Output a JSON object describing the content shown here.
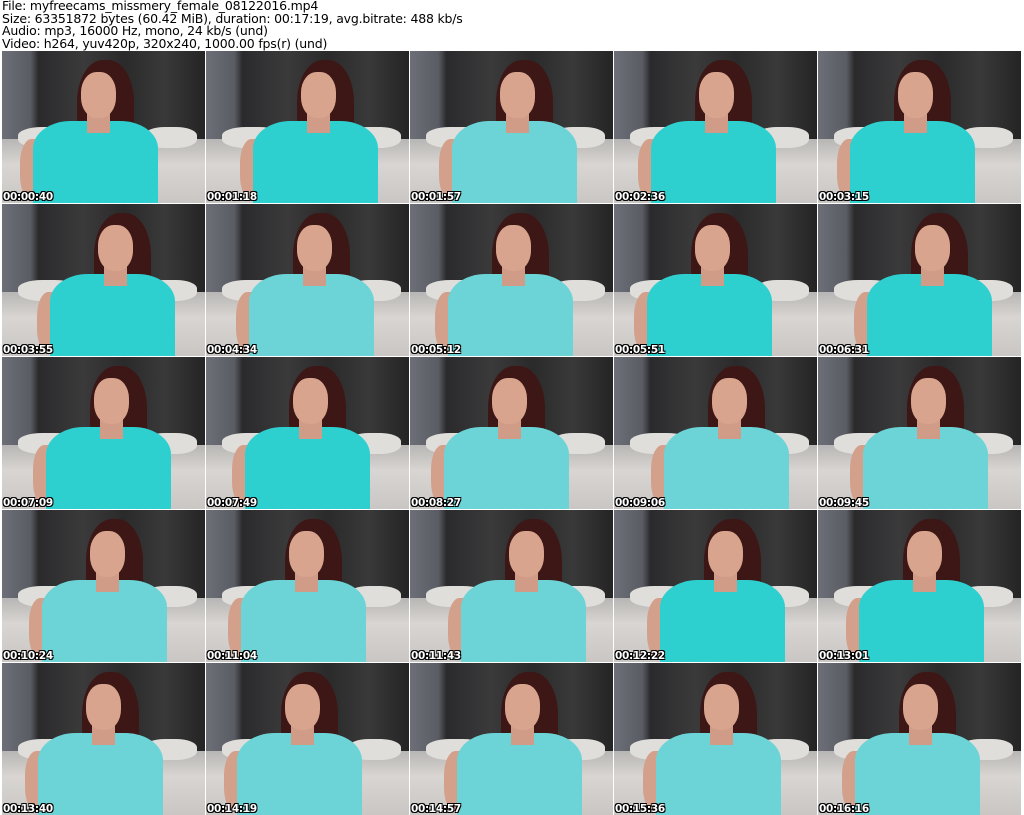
{
  "header": {
    "file": "File: myfreecams_missmery_female_08122016.mp4",
    "size": "Size: 63351872 bytes (60.42 MiB), duration: 00:17:19, avg.bitrate: 488 kb/s",
    "audio": "Audio: mp3, 16000 Hz, mono, 24 kb/s (und)",
    "video": "Video: h264, yuv420p, 320x240, 1000.00 fps(r) (und)"
  },
  "colors": {
    "shirt_bright": "#2ecfcf",
    "shirt_light": "#6cd4d6"
  },
  "thumbnails": [
    {
      "time": "00:00:40",
      "shirt": "bright"
    },
    {
      "time": "00:01:18",
      "shirt": "bright"
    },
    {
      "time": "00:01:57",
      "shirt": "light"
    },
    {
      "time": "00:02:36",
      "shirt": "bright"
    },
    {
      "time": "00:03:15",
      "shirt": "bright"
    },
    {
      "time": "00:03:55",
      "shirt": "bright"
    },
    {
      "time": "00:04:34",
      "shirt": "light"
    },
    {
      "time": "00:05:12",
      "shirt": "light"
    },
    {
      "time": "00:05:51",
      "shirt": "bright"
    },
    {
      "time": "00:06:31",
      "shirt": "bright"
    },
    {
      "time": "00:07:09",
      "shirt": "bright"
    },
    {
      "time": "00:07:49",
      "shirt": "bright"
    },
    {
      "time": "00:08:27",
      "shirt": "light"
    },
    {
      "time": "00:09:06",
      "shirt": "light"
    },
    {
      "time": "00:09:45",
      "shirt": "light"
    },
    {
      "time": "00:10:24",
      "shirt": "light"
    },
    {
      "time": "00:11:04",
      "shirt": "light"
    },
    {
      "time": "00:11:43",
      "shirt": "light"
    },
    {
      "time": "00:12:22",
      "shirt": "bright"
    },
    {
      "time": "00:13:01",
      "shirt": "bright"
    },
    {
      "time": "00:13:40",
      "shirt": "light"
    },
    {
      "time": "00:14:19",
      "shirt": "light"
    },
    {
      "time": "00:14:57",
      "shirt": "light"
    },
    {
      "time": "00:15:36",
      "shirt": "light"
    },
    {
      "time": "00:16:16",
      "shirt": "light"
    }
  ]
}
